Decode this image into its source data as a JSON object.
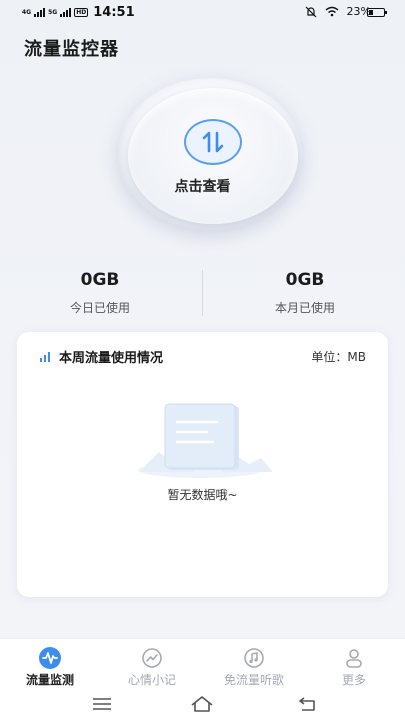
{
  "status_bar": {
    "network_1": "4G",
    "network_2": "5G",
    "hd": "HD",
    "time": "14:51",
    "battery": "23%"
  },
  "header": {
    "title": "流量监控器"
  },
  "check_button": {
    "label": "点击查看"
  },
  "stats": {
    "today": {
      "value": "0GB",
      "label": "今日已使用"
    },
    "month": {
      "value": "0GB",
      "label": "本月已使用"
    }
  },
  "weekly_card": {
    "title": "本周流量使用情况",
    "unit": "单位：MB",
    "empty_text": "暂无数据哦~"
  },
  "tabbar": {
    "items": [
      {
        "label": "流量监测",
        "icon": "waveform-icon",
        "active": true
      },
      {
        "label": "心情小记",
        "icon": "trend-circle-icon",
        "active": false
      },
      {
        "label": "免流量听歌",
        "icon": "music-note-icon",
        "active": false
      },
      {
        "label": "更多",
        "icon": "user-icon",
        "active": false
      }
    ]
  },
  "colors": {
    "accent": "#3f8cf0",
    "inactive": "#a6a9b0",
    "background": "#f1f3f8"
  }
}
